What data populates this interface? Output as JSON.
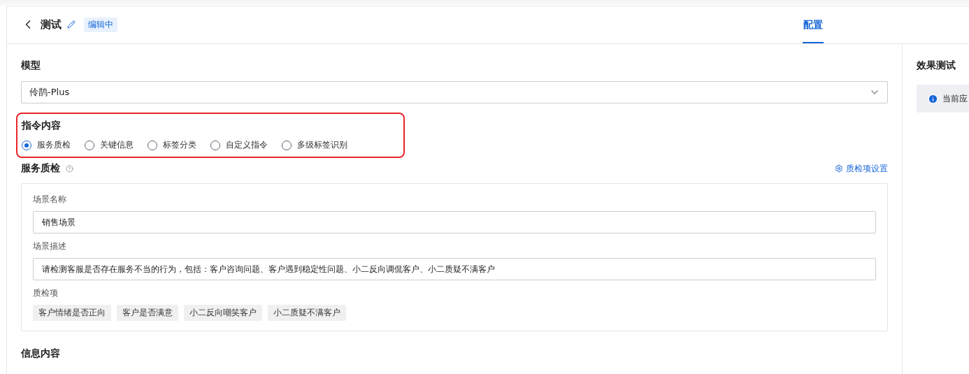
{
  "header": {
    "title": "测试",
    "badge": "编辑中",
    "tabs": [
      {
        "label": "配置",
        "selected": true
      }
    ]
  },
  "model": {
    "label": "模型",
    "value": "伶鹊-Plus"
  },
  "instruction": {
    "label": "指令内容",
    "highlighted": true,
    "options": [
      {
        "label": "服务质检",
        "selected": true
      },
      {
        "label": "关键信息",
        "selected": false
      },
      {
        "label": "标签分类",
        "selected": false
      },
      {
        "label": "自定义指令",
        "selected": false
      },
      {
        "label": "多级标签识别",
        "selected": false
      }
    ]
  },
  "service_check": {
    "title": "服务质检",
    "settings_link": "质检项设置",
    "scene_name": {
      "label": "场景名称",
      "value": "销售场景"
    },
    "scene_description": {
      "label": "场景描述",
      "value": "请检测客服是否存在服务不当的行为，包括：客户咨询问题、客户遇到稳定性问题、小二反向调侃客户、小二质疑不满客户"
    },
    "items_label": "质检项",
    "items": [
      "客户情绪是否正向",
      "客户是否满意",
      "小二反向嘲笑客户",
      "小二质疑不满客户"
    ]
  },
  "info_section": {
    "title": "信息内容"
  },
  "test_panel": {
    "title": "效果测试",
    "notice": "当前应"
  }
}
